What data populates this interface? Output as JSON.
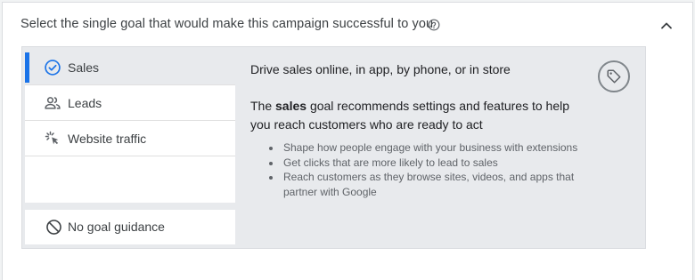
{
  "header": {
    "title": "Select the single goal that would make this campaign successful to you",
    "help_icon": "help-circle-icon",
    "collapse_icon": "chevron-up-icon"
  },
  "goals": [
    {
      "label": "Sales",
      "icon": "check-circle-icon",
      "selected": true
    },
    {
      "label": "Leads",
      "icon": "people-icon",
      "selected": false
    },
    {
      "label": "Website traffic",
      "icon": "cursor-click-icon",
      "selected": false
    }
  ],
  "no_goal": {
    "label": "No goal guidance",
    "icon": "block-icon"
  },
  "detail": {
    "title": "Drive sales online, in app, by phone, or in store",
    "desc_prefix": "The ",
    "desc_bold": "sales",
    "desc_suffix": " goal recommends settings and features to help you reach customers who are ready to act",
    "bullets": [
      "Shape how people engage with your business with extensions",
      "Get clicks that are more likely to lead to sales",
      "Reach customers as they browse sites, videos, and apps that partner with Google"
    ],
    "icon": "tag-icon"
  },
  "colors": {
    "accent": "#1a73e8",
    "panel": "#e8eaed"
  }
}
